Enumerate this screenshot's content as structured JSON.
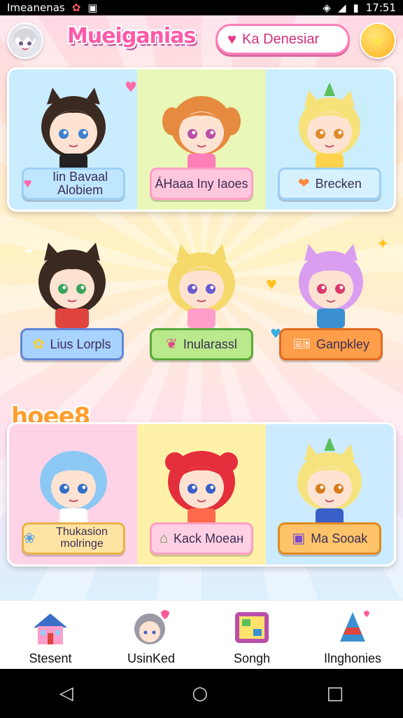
{
  "status_bar": {
    "app_label": "Imeanenas",
    "time": "17:51"
  },
  "header": {
    "title": "Mueiganias",
    "pill_label": "Ka Denesiar"
  },
  "rows": [
    {
      "cards": [
        {
          "label": "Iin Bavaal Alobiem",
          "label_color": "#bfe6ff",
          "icon": "heart-icon",
          "hair": "#3a2a22",
          "ears": true
        },
        {
          "label": "ÁHaaa Iny Iaoes",
          "label_color": "#ffc6dc",
          "icon": "none",
          "hair": "#e58a3f",
          "ears": false
        },
        {
          "label": "Brecken",
          "label_color": "#c9ecff",
          "icon": "rainbow-heart-icon",
          "hair": "#f7e27a",
          "ears": true
        }
      ],
      "bg": [
        "#c9ecff",
        "#e9f7b8",
        "#cbeefc"
      ]
    },
    {
      "cards": [
        {
          "label": "Lius Lorpls",
          "label_color": "#a8d2ff",
          "icon": "flower-icon",
          "hair": "#3a2a22",
          "ears": true
        },
        {
          "label": "Inularassl",
          "label_color": "#b9e98a",
          "icon": "sprout-icon",
          "hair": "#f5d96b",
          "ears": true
        },
        {
          "label": "Ganpkley",
          "label_color": "#ff9e4a",
          "icon": "ticket-icon",
          "hair": "#d99ef0",
          "ears": true
        }
      ],
      "bg": []
    },
    {
      "cards": [
        {
          "label": "Thukasion molringe",
          "label_color": "#ffe3a3",
          "icon": "pets-icon",
          "hair": "#8cc8f4",
          "ears": false
        },
        {
          "label": "Kack Moeaн",
          "label_color": "#ffd0e3",
          "icon": "house-icon",
          "hair": "#e52e3c",
          "ears": false
        },
        {
          "label": "Ma Sooak",
          "label_color": "#ffc46a",
          "icon": "gift-icon",
          "hair": "#f6e37e",
          "ears": true
        }
      ],
      "bg": [
        "#ffd3e6",
        "#fff2a8",
        "#cdebff"
      ]
    }
  ],
  "section_word": "hoee8",
  "bottom_nav": [
    {
      "label": "Stesent",
      "icon": "house-icon"
    },
    {
      "label": "UsinKed",
      "icon": "avatar-icon"
    },
    {
      "label": "Songh",
      "icon": "game-board-icon"
    },
    {
      "label": "Ilnghonies",
      "icon": "party-hat-icon"
    }
  ],
  "system_nav": {
    "back": "◁",
    "home": "○",
    "recents": "□"
  }
}
